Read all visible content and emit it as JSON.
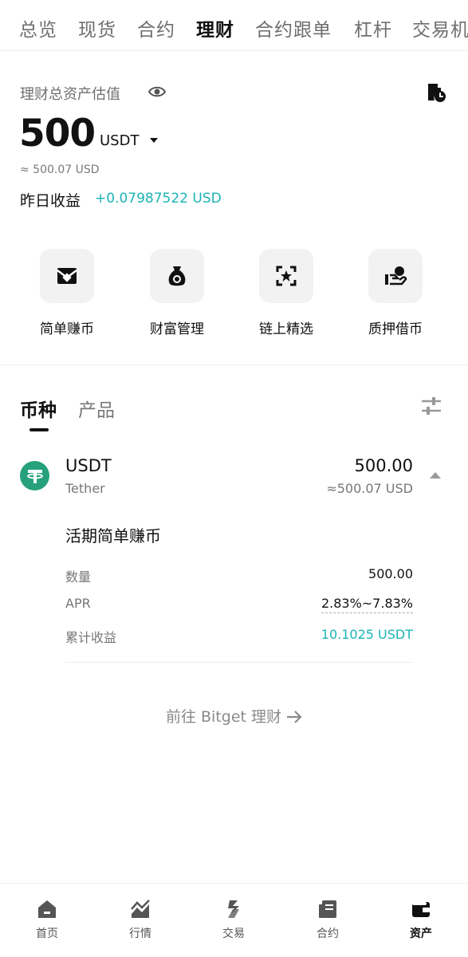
{
  "top_tabs": [
    "总览",
    "现货",
    "合约",
    "理财",
    "合约跟单",
    "杠杆",
    "交易机器人"
  ],
  "active_tab": "理财",
  "asset": {
    "label": "理财总资产估值",
    "value": "500",
    "unit": "USDT",
    "usd_equiv": "≈ 500.07 USD",
    "yesterday_label": "昨日收益",
    "yesterday_value": "+0.07987522 USD"
  },
  "actions": [
    {
      "label": "简单赚币",
      "icon": "simple-earn-icon"
    },
    {
      "label": "财富管理",
      "icon": "money-bag-icon"
    },
    {
      "label": "链上精选",
      "icon": "star-frame-icon"
    },
    {
      "label": "质押借币",
      "icon": "loan-hand-icon"
    }
  ],
  "section_tabs": [
    "币种",
    "产品"
  ],
  "coin": {
    "symbol": "USDT",
    "name": "Tether",
    "amount": "500.00",
    "usd": "≈500.07 USD"
  },
  "product": {
    "title": "活期简单赚币",
    "rows": [
      {
        "label": "数量",
        "value": "500.00"
      },
      {
        "label": "APR",
        "value": "2.83%~7.83%"
      },
      {
        "label": "累计收益",
        "value": "10.1025 USDT"
      }
    ]
  },
  "goto_link": "前往 Bitget 理财",
  "bottom_nav": [
    {
      "label": "首页",
      "icon": "home-icon"
    },
    {
      "label": "行情",
      "icon": "market-chart-icon"
    },
    {
      "label": "交易",
      "icon": "trade-icon"
    },
    {
      "label": "合约",
      "icon": "contract-icon"
    },
    {
      "label": "资产",
      "icon": "wallet-icon"
    }
  ],
  "colors": {
    "accent": "#1bb3b5",
    "tether": "#26a17b"
  }
}
